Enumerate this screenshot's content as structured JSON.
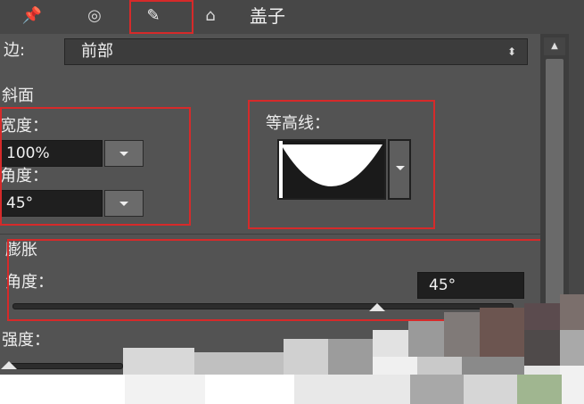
{
  "toolbar": {
    "icons": [
      "pin-icon",
      "eye-icon",
      "brush-icon",
      "cube-icon"
    ],
    "title": "盖子"
  },
  "side": {
    "label": "边:",
    "value": "前部"
  },
  "bevel": {
    "section": "斜面",
    "width_label": "宽度：",
    "width_value": "100%",
    "angle_label": "角度：",
    "angle_value": "45°",
    "contour_label": "等高线："
  },
  "dilate": {
    "section": "膨胀",
    "angle_label": "角度：",
    "angle_value": "45°",
    "slider_value": 0.73
  },
  "strength": {
    "label": "强度：",
    "slider_value": 0.03
  },
  "colors": {
    "highlight": "#d62a2a"
  }
}
